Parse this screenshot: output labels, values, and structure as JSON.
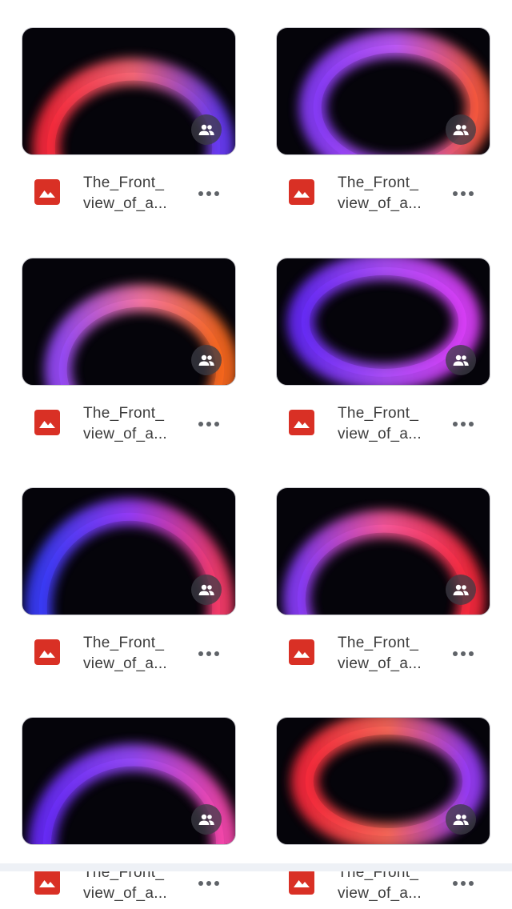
{
  "files": [
    {
      "name_line1": "The_Front_",
      "name_line2": "view_of_a...",
      "colors": [
        "#ff2a3c",
        "#ff6b7a",
        "#6a3cff"
      ]
    },
    {
      "name_line1": "The_Front_",
      "name_line2": "view_of_a...",
      "colors": [
        "#8a3cff",
        "#c45cff",
        "#ff5a3c"
      ]
    },
    {
      "name_line1": "The_Front_",
      "name_line2": "view_of_a...",
      "colors": [
        "#9a4cff",
        "#ff7aa8",
        "#ff6a1a"
      ]
    },
    {
      "name_line1": "The_Front_",
      "name_line2": "view_of_a...",
      "colors": [
        "#6a2cff",
        "#b050ff",
        "#e040ff"
      ]
    },
    {
      "name_line1": "The_Front_",
      "name_line2": "view_of_a...",
      "colors": [
        "#3a3cff",
        "#9a3cff",
        "#ff3c6a"
      ]
    },
    {
      "name_line1": "The_Front_",
      "name_line2": "view_of_a...",
      "colors": [
        "#8a3cff",
        "#ff5aa0",
        "#ff2a3c"
      ]
    },
    {
      "name_line1": "The_Front_",
      "name_line2": "view_of_a...",
      "colors": [
        "#6a2cff",
        "#9a4cff",
        "#ff4ab0"
      ]
    },
    {
      "name_line1": "The_Front_",
      "name_line2": "view_of_a...",
      "colors": [
        "#ff2a3c",
        "#ff6a5a",
        "#9a3cff"
      ]
    }
  ],
  "icons": {
    "file_type": "image-file-icon",
    "shared": "shared-people-icon",
    "more": "more-dots-icon"
  },
  "accent": "#d93025"
}
